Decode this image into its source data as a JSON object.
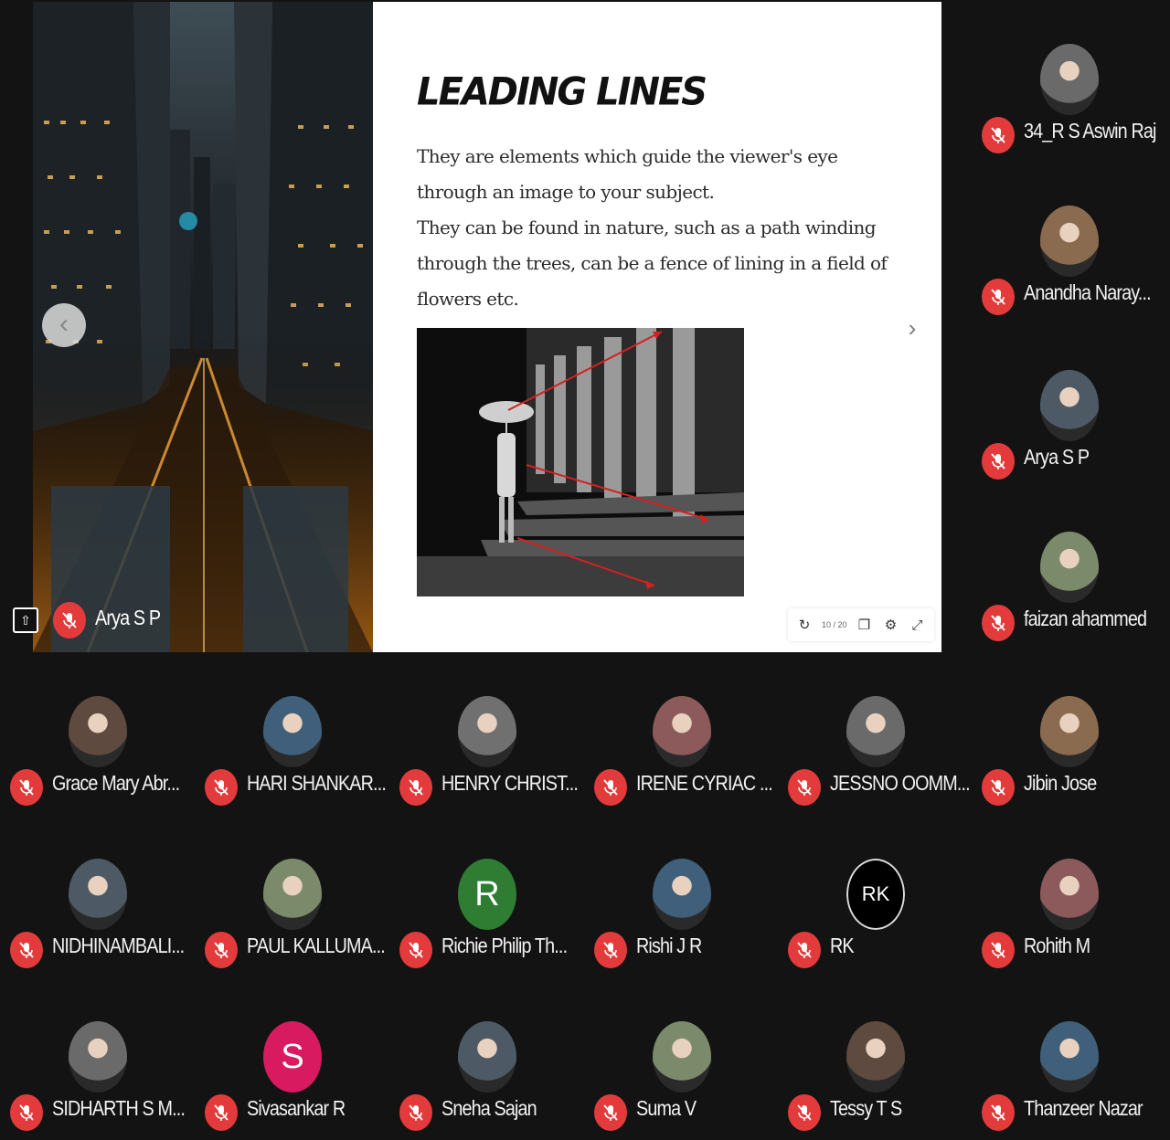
{
  "slide": {
    "title": "LEADING LINES",
    "paragraph_1": "They are elements which guide the viewer's eye through an image to your subject.",
    "paragraph_2": "They can be found in nature, such as a path winding through the trees, can be a fence of lining in a field of flowers etc.",
    "page_indicator": "10 / 20"
  },
  "presenter": {
    "name": "Arya S P"
  },
  "participants": [
    {
      "name": "34_R S Aswin Raj"
    },
    {
      "name": "Anandha Naray..."
    },
    {
      "name": "Arya S P"
    },
    {
      "name": "faizan ahammed"
    },
    {
      "name": "Grace Mary Abr..."
    },
    {
      "name": "HARI SHANKAR..."
    },
    {
      "name": "HENRY CHRIST..."
    },
    {
      "name": "IRENE CYRIAC ..."
    },
    {
      "name": "JESSNO OOMM..."
    },
    {
      "name": "Jibin Jose"
    },
    {
      "name": "NIDHINAMBALI..."
    },
    {
      "name": "PAUL KALLUMA..."
    },
    {
      "name": "Richie Philip Th...",
      "initial": "R",
      "color": "#2e7d32"
    },
    {
      "name": "Rishi J R"
    },
    {
      "name": "RK",
      "initial": "RK"
    },
    {
      "name": "Rohith M"
    },
    {
      "name": "SIDHARTH S M..."
    },
    {
      "name": "Sivasankar R",
      "initial": "S",
      "color": "#d81b60"
    },
    {
      "name": "Sneha Sajan"
    },
    {
      "name": "Suma V"
    },
    {
      "name": "Tessy T S"
    },
    {
      "name": "Thanzeer Nazar"
    }
  ],
  "colors": {
    "mute_red": "#e33b3b",
    "background": "#131313",
    "slide_arrow_red": "#d32020"
  },
  "icons": [
    "mic-off-icon",
    "present-to-all-icon",
    "chevron-left-icon",
    "chevron-right-icon",
    "refresh-icon",
    "window-icon",
    "settings-icon",
    "collapse-icon"
  ]
}
